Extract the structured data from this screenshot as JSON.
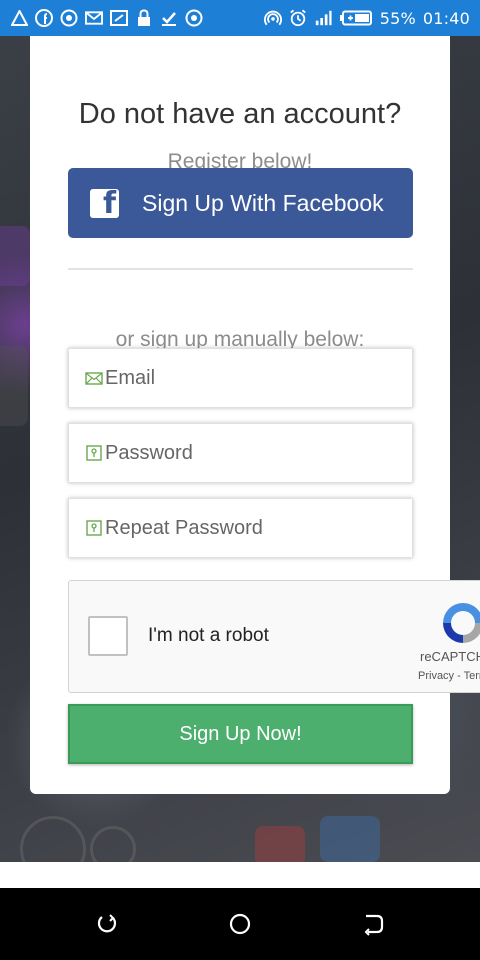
{
  "status_bar": {
    "battery": "55%",
    "time": "01:40",
    "left_icons": [
      "alert-icon",
      "facebook-icon",
      "whatsapp-icon",
      "gmail-icon",
      "screenshot-icon",
      "lock-icon",
      "download-done-icon",
      "record-icon"
    ],
    "right_icons": [
      "hotspot-icon",
      "alarm-icon",
      "signal-icon",
      "battery-icon"
    ],
    "background_color": "#1e7fd6"
  },
  "form": {
    "title": "Do not have an account?",
    "subtitle": "Register below!",
    "facebook_button": "Sign Up With Facebook",
    "manual_text": "or sign up manually below:",
    "email_placeholder": "Email",
    "password_placeholder": "Password",
    "repeat_password_placeholder": "Repeat Password",
    "submit_button": "Sign Up Now!",
    "facebook_color": "#3b5998",
    "submit_color": "#4caf6d"
  },
  "recaptcha": {
    "label": "I'm not a robot",
    "brand": "reCAPTCHA",
    "links": "Privacy - Terms"
  },
  "nav_bar": {
    "buttons": [
      "recent-apps-icon",
      "home-icon",
      "back-icon"
    ]
  }
}
